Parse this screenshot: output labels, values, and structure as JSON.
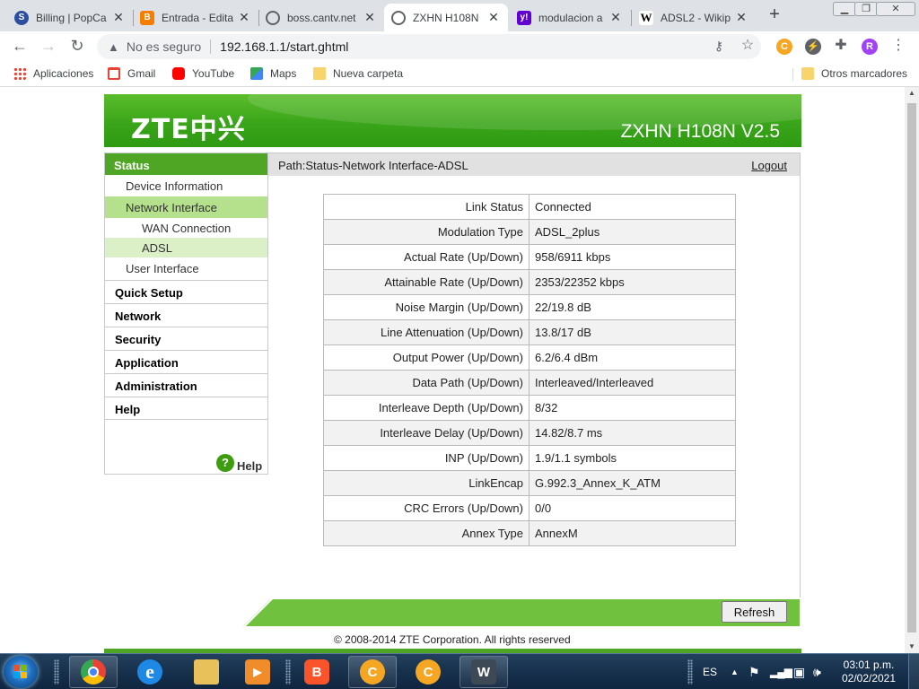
{
  "browser": {
    "tabs": [
      {
        "title": "Billing | PopCa",
        "favicon": "popcart-icon",
        "color": "#2b4f9e"
      },
      {
        "title": "Entrada - Edita",
        "favicon": "blogger-icon",
        "color": "#f57d00"
      },
      {
        "title": "boss.cantv.net",
        "favicon": "globe-icon",
        "color": "#5f6368"
      },
      {
        "title": "ZXHN H108N",
        "favicon": "globe-icon",
        "color": "#5f6368",
        "active": true
      },
      {
        "title": "modulacion a",
        "favicon": "yahoo-icon",
        "color": "#6001d2"
      },
      {
        "title": "ADSL2 - Wikip",
        "favicon": "wikipedia-icon",
        "color": "#000000"
      }
    ],
    "tab_close": "✕",
    "new_tab": "+",
    "security_label": "No es seguro",
    "url": "192.168.1.1/start.ghtml",
    "profile_initial": "R"
  },
  "bookmarks": [
    {
      "label": "Aplicaciones",
      "icon": "apps-grid-icon"
    },
    {
      "label": "Gmail",
      "icon": "gmail-icon"
    },
    {
      "label": "YouTube",
      "icon": "youtube-icon"
    },
    {
      "label": "Maps",
      "icon": "maps-icon"
    },
    {
      "label": "Nueva carpeta",
      "icon": "folder-icon"
    }
  ],
  "other_bookmarks": "Otros marcadores",
  "router": {
    "brand": "ZTE中兴",
    "model": "ZXHN H108N V2.5",
    "path": "Path:Status-Network Interface-ADSL",
    "logout": "Logout",
    "menu": {
      "status": "Status",
      "device_information": "Device Information",
      "network_interface": "Network Interface",
      "wan_connection": "WAN Connection",
      "adsl": "ADSL",
      "user_interface": "User Interface",
      "quick_setup": "Quick Setup",
      "network": "Network",
      "security": "Security",
      "application": "Application",
      "administration": "Administration",
      "help": "Help"
    },
    "help_label": "Help",
    "refresh": "Refresh",
    "copyright": "© 2008-2014 ZTE Corporation. All rights reserved",
    "status_rows": [
      {
        "label": "Link Status",
        "value": "Connected"
      },
      {
        "label": "Modulation Type",
        "value": "ADSL_2plus"
      },
      {
        "label": "Actual Rate (Up/Down)",
        "value": "958/6911 kbps"
      },
      {
        "label": "Attainable Rate (Up/Down)",
        "value": "2353/22352 kbps"
      },
      {
        "label": "Noise Margin (Up/Down)",
        "value": "22/19.8 dB"
      },
      {
        "label": "Line Attenuation (Up/Down)",
        "value": "13.8/17 dB"
      },
      {
        "label": "Output Power (Up/Down)",
        "value": "6.2/6.4 dBm"
      },
      {
        "label": "Data Path (Up/Down)",
        "value": "Interleaved/Interleaved"
      },
      {
        "label": "Interleave Depth (Up/Down)",
        "value": "8/32"
      },
      {
        "label": "Interleave Delay (Up/Down)",
        "value": "14.82/8.7 ms"
      },
      {
        "label": "INP (Up/Down)",
        "value": "1.9/1.1 symbols"
      },
      {
        "label": "LinkEncap",
        "value": "G.992.3_Annex_K_ATM"
      },
      {
        "label": "CRC Errors (Up/Down)",
        "value": "0/0"
      },
      {
        "label": "Annex Type",
        "value": "AnnexM"
      }
    ]
  },
  "taskbar": {
    "language": "ES",
    "time": "03:01 p.m.",
    "date": "02/02/2021",
    "apps": [
      "chrome-icon",
      "internet-explorer-icon",
      "file-explorer-icon",
      "media-player-icon",
      "brave-icon",
      "ccleaner-icon",
      "ccleaner-icon",
      "wunderlist-icon"
    ]
  },
  "colors": {
    "zte_green": "#4ea624",
    "menu_highlight": "#b5e08c",
    "submenu_highlight": "#dcf0c8"
  }
}
